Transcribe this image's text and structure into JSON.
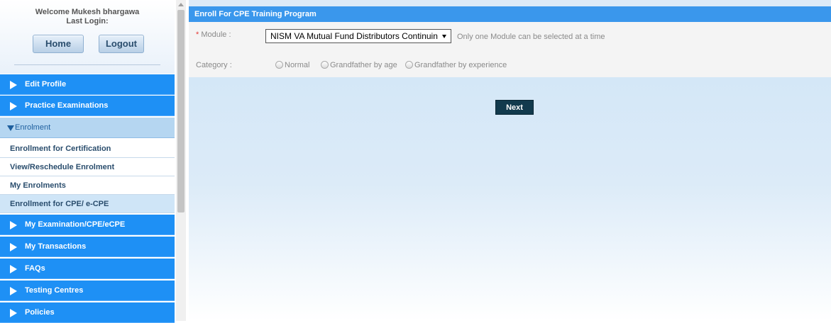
{
  "sidebar": {
    "welcome": "Welcome Mukesh bhargawa",
    "last_login": "Last Login:",
    "home_label": "Home",
    "logout_label": "Logout",
    "menu": {
      "edit_profile": "Edit Profile",
      "practice_exams": "Practice Examinations",
      "enrolment": "Enrolment",
      "sub_items": [
        "Enrollment for Certification",
        "View/Reschedule Enrolment",
        "My Enrolments",
        "Enrollment for CPE/ e-CPE"
      ],
      "my_exams": "My Examination/CPE/eCPE",
      "my_transactions": "My Transactions",
      "faqs": "FAQs",
      "testing_centres": "Testing Centres",
      "policies": "Policies"
    }
  },
  "main": {
    "header": "Enroll For CPE Training Program",
    "module_label_req": "*",
    "module_label": "Module :",
    "module_value": "NISM VA Mutual Fund Distributors Continuing Professional Education",
    "module_note": "Only one Module can be selected at a time",
    "category_label": "Category :",
    "category_options": [
      "Normal",
      "Grandfather by age",
      "Grandfather by experience"
    ],
    "next_label": "Next"
  },
  "colors": {
    "menu_blue": "#1e90f5",
    "header_blue": "#3a97ec",
    "next_button": "#123a4d"
  }
}
